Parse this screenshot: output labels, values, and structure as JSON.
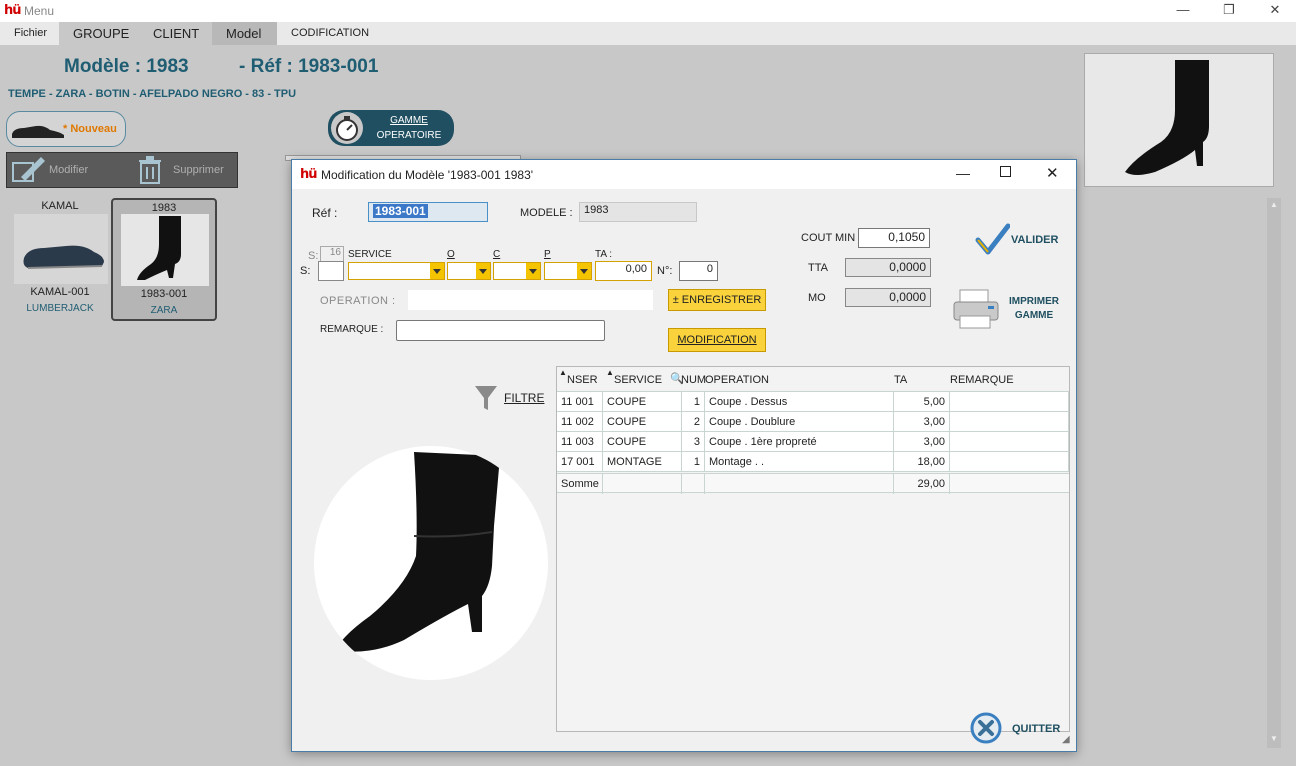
{
  "app": {
    "title": "Menu",
    "logo": "hü"
  },
  "menu": [
    "Fichier",
    "GROUPE",
    "CLIENT",
    "Model",
    "CODIFICATION"
  ],
  "header": {
    "model": "Modèle : 1983",
    "ref": "- Réf :  1983-001",
    "description": "TEMPE - ZARA - BOTIN - AFELPADO NEGRO - 83 - TPU",
    "nouveau": "* Nouveau",
    "gamme_line1": "GAMME",
    "gamme_line2": "OPERATOIRE",
    "modifier": "Modifier",
    "supprimer": "Supprimer"
  },
  "cards": [
    {
      "top": "KAMAL",
      "code": "KAMAL-001",
      "client": "LUMBERJACK"
    },
    {
      "top": "1983",
      "code": "1983-001",
      "client": "ZARA"
    }
  ],
  "dialog": {
    "title": "Modification du Modèle '1983-001 1983'",
    "ref_label": "Réf :",
    "ref_value": "1983-001",
    "modele_label": "MODELE :",
    "modele_value": "1983",
    "s_label": "S:",
    "s_top_label": "S:",
    "s_top_value": "16",
    "service_label": "SERVICE",
    "o_label": "O",
    "c_label": "C",
    "p_label": "P",
    "ta_label": "TA :",
    "ta_value": "0,00",
    "no_label": "N°:",
    "no_value": "0",
    "operation_label": "OPERATION :",
    "remarque_label": "REMARQUE :",
    "enregistrer": "± ENREGISTRER",
    "modification": "MODIFICATION",
    "cout_min_label": "COUT MIN",
    "cout_min_value": "0,1050",
    "tta_label": "TTA",
    "tta_value": "0,0000",
    "mo_label": "MO",
    "mo_value": "0,0000",
    "valider": "VALIDER",
    "imprimer_line1": "IMPRIMER",
    "imprimer_line2": "GAMME",
    "filtre": "FILTRE",
    "quitter": "QUITTER"
  },
  "grid": {
    "headers": [
      "NSER",
      "SERVICE",
      "NUM",
      "OPERATION",
      "TA",
      "REMARQUE"
    ],
    "rows": [
      [
        "11 001",
        "COUPE",
        "1",
        "Coupe  . Dessus",
        "5,00",
        ""
      ],
      [
        "11 002",
        "COUPE",
        "2",
        "Coupe  . Doublure",
        "3,00",
        ""
      ],
      [
        "11 003",
        "COUPE",
        "3",
        "Coupe  . 1ère propreté",
        "3,00",
        ""
      ],
      [
        "17 001",
        "MONTAGE",
        "1",
        "Montage  .  .",
        "18,00",
        ""
      ]
    ],
    "total_label": "Somme",
    "total_value": "29,00"
  },
  "colors": {
    "accent": "#1f5d73",
    "yellow": "#fad33c",
    "logo_red": "#d10000"
  }
}
